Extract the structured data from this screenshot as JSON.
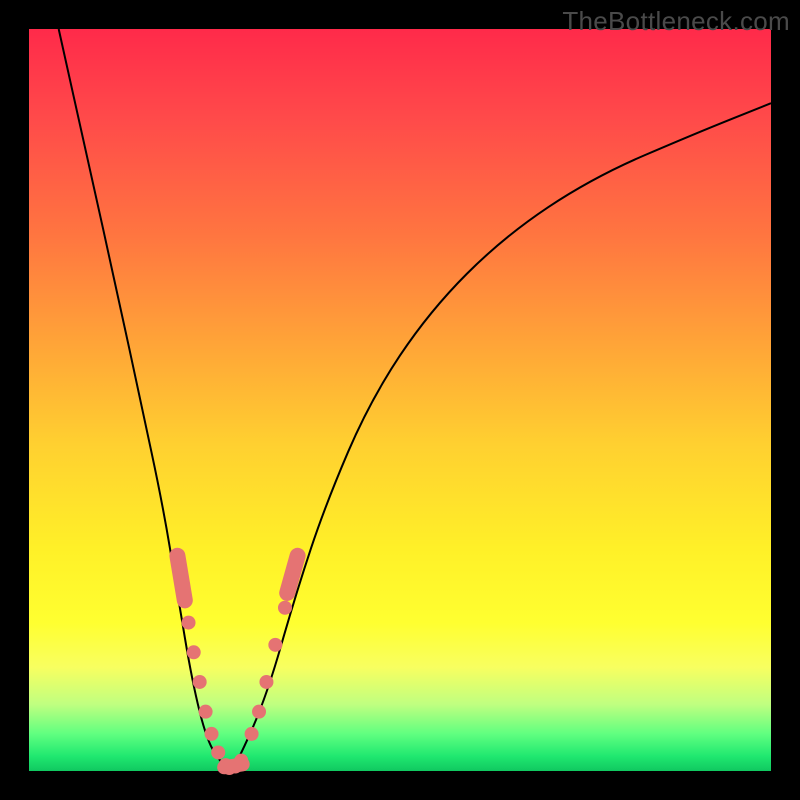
{
  "watermark": "TheBottleneck.com",
  "chart_data": {
    "type": "line",
    "title": "",
    "xlabel": "",
    "ylabel": "",
    "ylim": [
      0,
      100
    ],
    "xlim": [
      0,
      100
    ],
    "series": [
      {
        "name": "bottleneck-curve",
        "x": [
          4,
          8,
          12,
          15,
          18,
          20,
          22,
          24,
          26,
          27,
          28,
          32,
          36,
          40,
          46,
          54,
          64,
          76,
          90,
          100
        ],
        "y": [
          100,
          82,
          64,
          50,
          36,
          24,
          12,
          4,
          1,
          0,
          1,
          10,
          24,
          36,
          50,
          62,
          72,
          80,
          86,
          90
        ]
      }
    ],
    "markers": {
      "left_arm": [
        {
          "x": 20.5,
          "y": 26
        },
        {
          "x": 21.5,
          "y": 20
        },
        {
          "x": 22.2,
          "y": 16
        },
        {
          "x": 23.0,
          "y": 12
        },
        {
          "x": 23.8,
          "y": 8
        },
        {
          "x": 24.6,
          "y": 5
        },
        {
          "x": 25.5,
          "y": 2.5
        }
      ],
      "bottom": [
        {
          "x": 26.5,
          "y": 0.8
        },
        {
          "x": 27.0,
          "y": 0.4
        },
        {
          "x": 27.8,
          "y": 0.6
        },
        {
          "x": 28.6,
          "y": 1.4
        }
      ],
      "right_arm": [
        {
          "x": 30.0,
          "y": 5
        },
        {
          "x": 31.0,
          "y": 8
        },
        {
          "x": 32.0,
          "y": 12
        },
        {
          "x": 33.2,
          "y": 17
        },
        {
          "x": 34.5,
          "y": 22
        },
        {
          "x": 35.5,
          "y": 26
        }
      ],
      "left_pill": {
        "x1": 20.0,
        "y1": 29,
        "x2": 21.0,
        "y2": 23
      },
      "right_pill": {
        "x1": 34.8,
        "y1": 24,
        "x2": 36.2,
        "y2": 29
      }
    },
    "background_gradient": [
      {
        "stop": 0.0,
        "color": "#ff2a4a"
      },
      {
        "stop": 0.5,
        "color": "#ffd030"
      },
      {
        "stop": 0.8,
        "color": "#ffff30"
      },
      {
        "stop": 1.0,
        "color": "#10c860"
      }
    ]
  }
}
